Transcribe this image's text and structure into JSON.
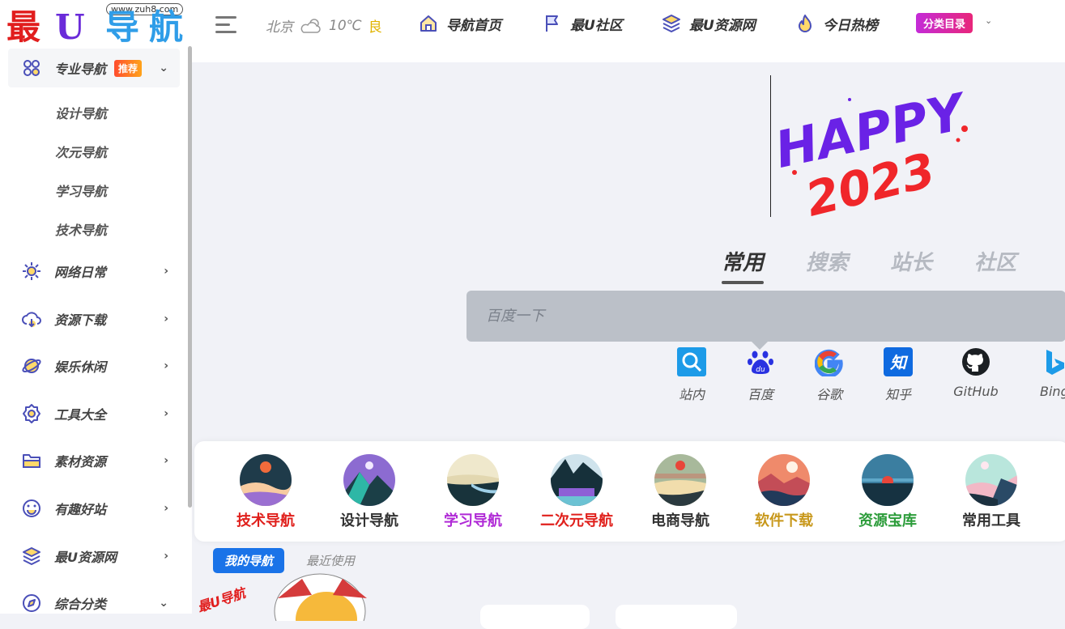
{
  "logo": {
    "url": "www.zuh8.com",
    "chars": [
      "最",
      "U",
      "导",
      "航"
    ],
    "colors": [
      "#e11d1d",
      "#6a2bd9",
      "#2f9de8",
      "#2f9de8"
    ]
  },
  "weather": {
    "city": "北京",
    "temp": "10℃",
    "air": "良"
  },
  "topnav": [
    {
      "label": "导航首页",
      "icon": "home-icon"
    },
    {
      "label": "最U社区",
      "icon": "flag-icon"
    },
    {
      "label": "最U资源网",
      "icon": "layers-icon"
    },
    {
      "label": "今日热榜",
      "icon": "flame-icon"
    }
  ],
  "category_button": "分类目录",
  "sidebar": {
    "first": {
      "label": "专业导航",
      "badge": "推荐",
      "icon": "grid-icon"
    },
    "subitems": [
      "设计导航",
      "次元导航",
      "学习导航",
      "技术导航"
    ],
    "items": [
      {
        "label": "网络日常",
        "icon": "sun-icon"
      },
      {
        "label": "资源下载",
        "icon": "cloud-download-icon"
      },
      {
        "label": "娱乐休闲",
        "icon": "planet-icon"
      },
      {
        "label": "工具大全",
        "icon": "gear-icon"
      },
      {
        "label": "素材资源",
        "icon": "folder-icon"
      },
      {
        "label": "有趣好站",
        "icon": "smile-icon"
      },
      {
        "label": "最U资源网",
        "icon": "layers-icon"
      },
      {
        "label": "综合分类",
        "icon": "compass-icon"
      }
    ]
  },
  "banner": {
    "text1": "HAPPY",
    "text2": "2023"
  },
  "search": {
    "tabs": [
      "常用",
      "搜索",
      "站长",
      "社区"
    ],
    "active_tab": "常用",
    "placeholder": "百度一下",
    "engines": [
      "站内",
      "百度",
      "谷歌",
      "知乎",
      "GitHub",
      "Bing"
    ]
  },
  "categories": [
    {
      "label": "技术导航",
      "color": "#e0201c"
    },
    {
      "label": "设计导航",
      "color": "#333333"
    },
    {
      "label": "学习导航",
      "color": "#b02ad6"
    },
    {
      "label": "二次元导航",
      "color": "#e0201c"
    },
    {
      "label": "电商导航",
      "color": "#333333"
    },
    {
      "label": "软件下载",
      "color": "#c8981c"
    },
    {
      "label": "资源宝库",
      "color": "#2c9c3a"
    },
    {
      "label": "常用工具",
      "color": "#333333"
    }
  ],
  "bottom_tabs": {
    "mine": "我的导航",
    "recent": "最近使用"
  },
  "mascot_logo": "最U导航"
}
